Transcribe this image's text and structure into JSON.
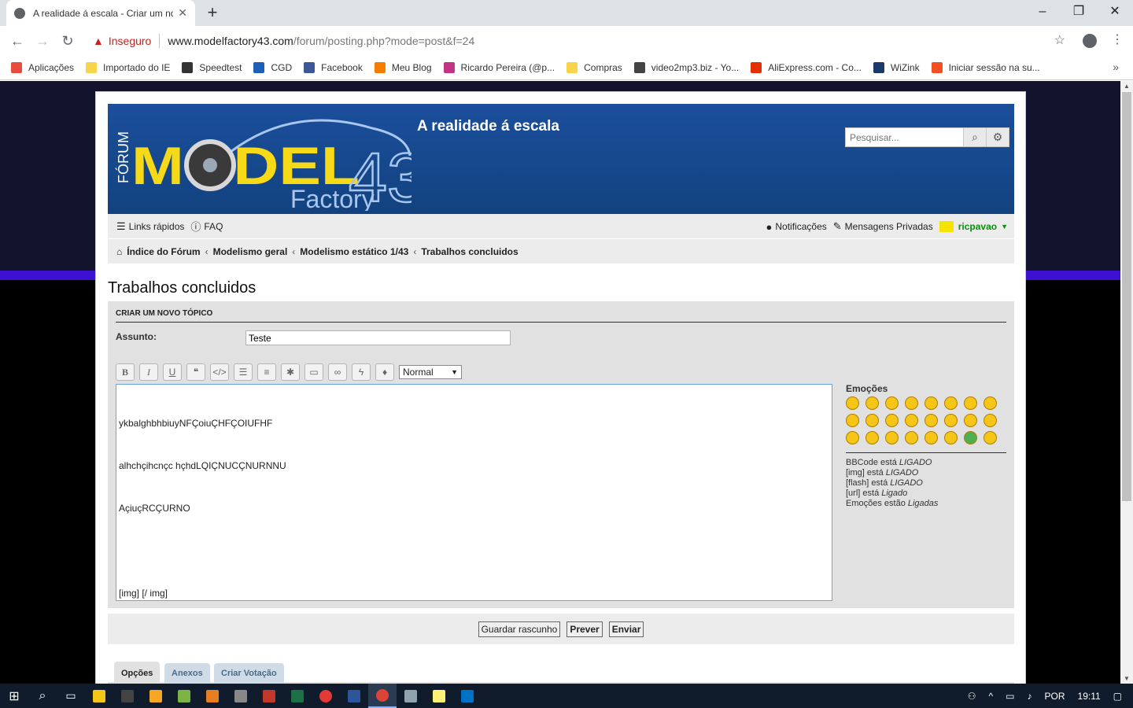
{
  "browser": {
    "tab_title": "A realidade á escala - Criar um no",
    "new_tab": "+",
    "omnibox": {
      "insecure_label": "Inseguro",
      "host": "www.modelfactory43.com",
      "path": "/forum/posting.php?mode=post&f=24"
    },
    "bookmarks": [
      {
        "label": "Aplicações",
        "color": "#e84c3d"
      },
      {
        "label": "Importado do IE",
        "color": "#f7d44a"
      },
      {
        "label": "Speedtest",
        "color": "#333333"
      },
      {
        "label": "CGD",
        "color": "#1f5fb8"
      },
      {
        "label": "Facebook",
        "color": "#3b5998"
      },
      {
        "label": "Meu Blog",
        "color": "#f57d00"
      },
      {
        "label": "Ricardo Pereira (@p...",
        "color": "#c13584"
      },
      {
        "label": "Compras",
        "color": "#f7d44a"
      },
      {
        "label": "video2mp3.biz - Yo...",
        "color": "#444444"
      },
      {
        "label": "AliExpress.com - Co...",
        "color": "#e62e04"
      },
      {
        "label": "WiZink",
        "color": "#1b3a6b"
      },
      {
        "label": "Iniciar sessão na su...",
        "color": "#f25022"
      }
    ]
  },
  "site": {
    "tagline": "A realidade á escala",
    "search_placeholder": "Pesquisar...",
    "logo": {
      "vertical": "FÓRUM",
      "main": "MODEL",
      "digits": "43",
      "sub": "Factory"
    }
  },
  "nav": {
    "quick_links": "Links rápidos",
    "faq": "FAQ",
    "notifications": "Notificações",
    "private_messages": "Mensagens Privadas",
    "username": "ricpavao",
    "breadcrumbs": [
      "Índice do Fórum",
      "Modelismo geral",
      "Modelismo estático 1/43",
      "Trabalhos concluidos"
    ]
  },
  "page": {
    "title": "Trabalhos concluidos",
    "section_header": "CRIAR UM NOVO TÓPICO",
    "subject_label": "Assunto:",
    "subject_value": "Teste",
    "font_size_select": "Normal",
    "message_lines": [
      "ykbalghbhbiuyNFÇoiuÇHFÇOIUFHF",
      "alhchçihcnçc hçhdLQIÇNUCÇNURNNU",
      "AçiuçRCÇURNO",
      "",
      "[img] [/ img]"
    ],
    "emoticons_label": "Emoções",
    "status": [
      {
        "text": "BBCode está ",
        "state": "LIGADO"
      },
      {
        "text": "[img] está ",
        "state": "LIGADO"
      },
      {
        "text": "[flash] está ",
        "state": "LIGADO"
      },
      {
        "text": "[url] está ",
        "state": "Ligado"
      },
      {
        "text": "Emoções estão ",
        "state": "Ligadas"
      }
    ],
    "buttons": {
      "save_draft": "Guardar rascunho",
      "preview": "Prever",
      "submit": "Enviar"
    },
    "tabs": [
      "Opções",
      "Anexos",
      "Criar Votação"
    ]
  },
  "taskbar": {
    "lang": "POR",
    "time": "19:11"
  }
}
